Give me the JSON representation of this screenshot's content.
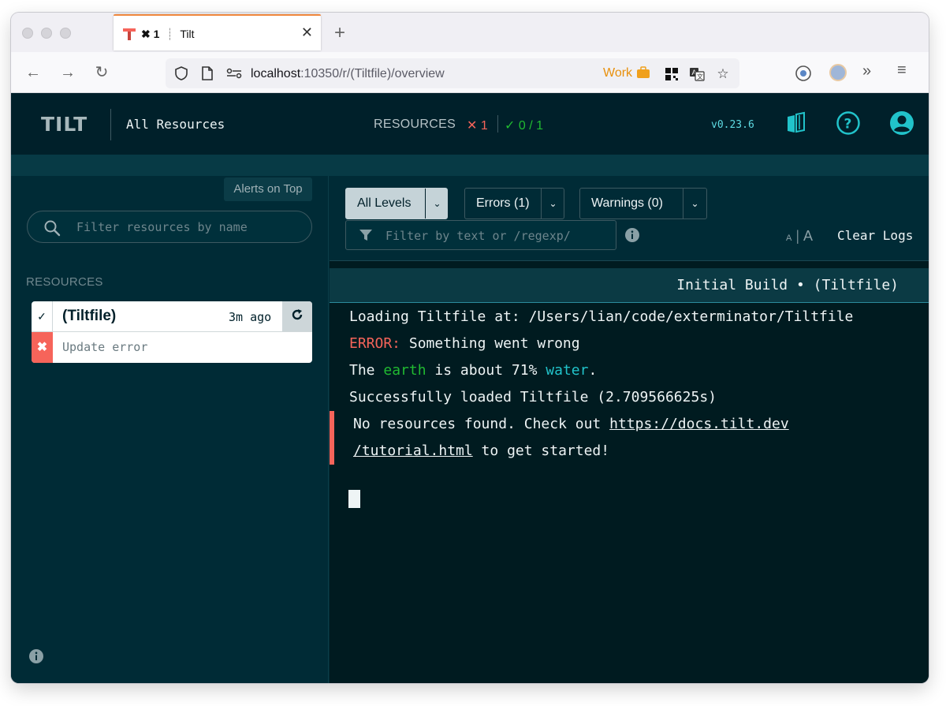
{
  "browser": {
    "tab": {
      "badge": "✖ 1",
      "title": "Tilt"
    },
    "url": {
      "host": "localhost",
      "path": ":10350/r/(Tiltfile)/overview"
    },
    "container_label": "Work"
  },
  "header": {
    "logo_text": "TILT",
    "title": "All Resources",
    "resources_label": "RESOURCES",
    "error_count": "✕ 1",
    "ok_count": "✓ 0 / 1",
    "version": "v0.23.6"
  },
  "sidebar": {
    "alerts_on_top": "Alerts on Top",
    "filter_placeholder": "Filter resources by name",
    "heading": "RESOURCES",
    "resources": [
      {
        "name": "(Tiltfile)",
        "time": "3m ago",
        "status": "Update error"
      }
    ]
  },
  "logs": {
    "levels": {
      "all": "All Levels",
      "errors": "Errors (1)",
      "warnings": "Warnings (0)"
    },
    "filter_placeholder": "Filter by text or /regexp/",
    "font_small": "A",
    "font_large": "A",
    "clear": "Clear Logs",
    "build_title": "Initial Build • (Tiltfile)",
    "line1": "Loading Tiltfile at: /Users/lian/code/exterminator/Tiltfile",
    "line2_prefix": "ERROR:",
    "line2_text": " Something went wrong",
    "line3_a": "The ",
    "line3_b": "earth",
    "line3_c": " is about 71% ",
    "line3_d": "water",
    "line3_e": ".",
    "line4": "Successfully loaded Tiltfile (2.709566625s)",
    "line5_text": "No resources found. Check out ",
    "line5_link": "https://docs.tilt.dev",
    "line6_link": "/tutorial.html",
    "line6_text": " to get started!"
  },
  "colors": {
    "background": "#002b36",
    "log_background": "#001b20",
    "error": "#f6645a",
    "success": "#20ba31",
    "accent": "#21c3ca"
  },
  "icons": [
    "tilt-favicon-icon",
    "close-icon",
    "plus-icon",
    "back-icon",
    "forward-icon",
    "reload-icon",
    "shield-icon",
    "page-icon",
    "permissions-icon",
    "briefcase-icon",
    "qr-icon",
    "translate-icon",
    "star-icon",
    "extension-icon",
    "avatar-icon",
    "overflow-icon",
    "menu-icon",
    "docs-icon",
    "help-icon",
    "account-icon",
    "search-icon",
    "check-icon",
    "refresh-icon",
    "error-x-icon",
    "info-icon",
    "filter-icon",
    "chevron-down-icon"
  ]
}
